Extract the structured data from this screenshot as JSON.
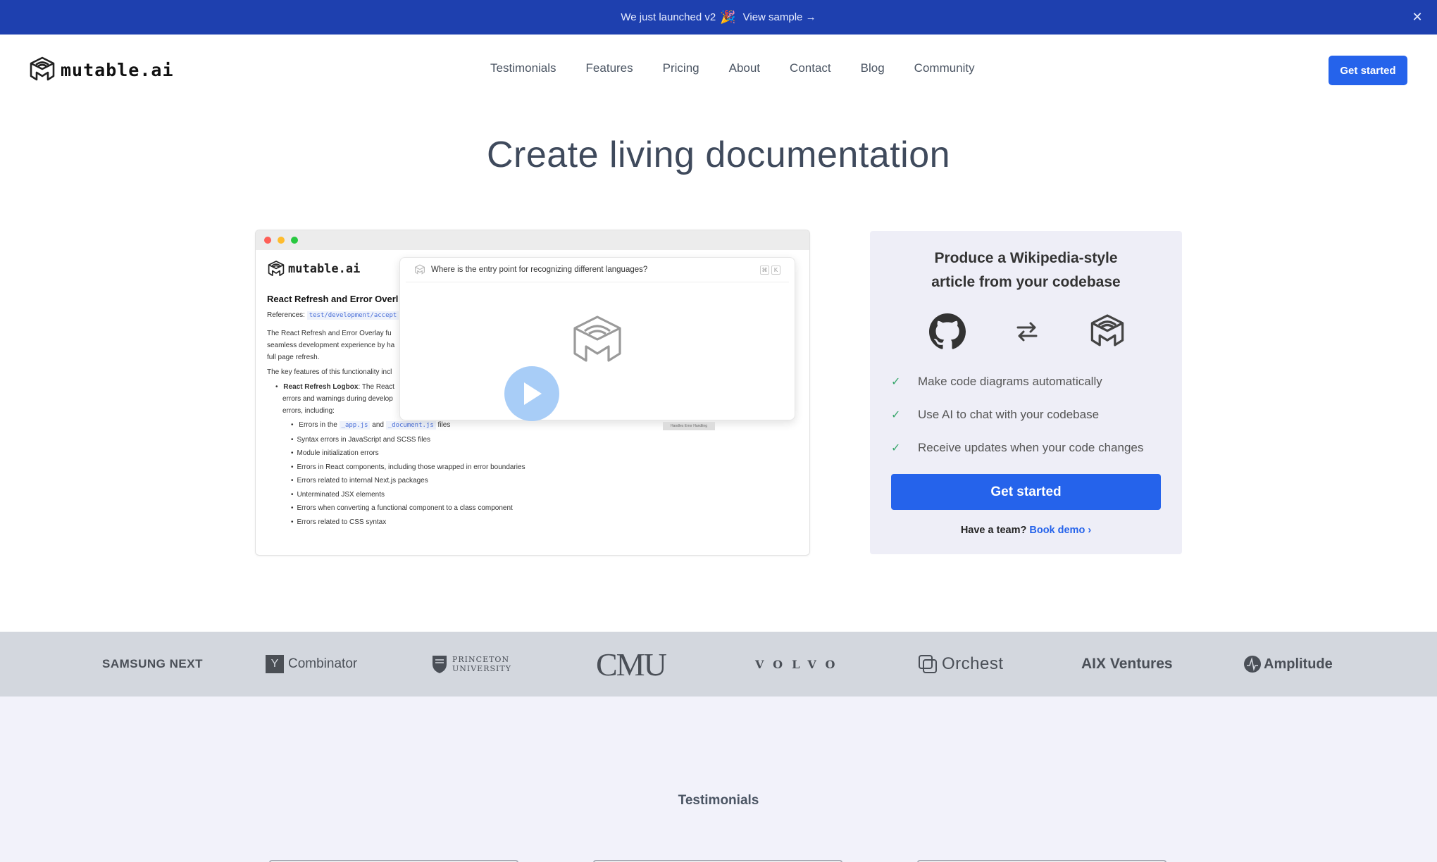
{
  "announcement": {
    "text": "We just launched v2",
    "emoji": "🎉",
    "link_label": "View sample →",
    "close_label": "✕"
  },
  "header": {
    "logo_text": "mutable.ai",
    "nav": [
      "Testimonials",
      "Features",
      "Pricing",
      "About",
      "Contact",
      "Blog",
      "Community"
    ],
    "cta_label": "Get started"
  },
  "hero": {
    "title": "Create living documentation"
  },
  "demo": {
    "logo_text": "mutable.ai",
    "doc_title": "React Refresh and Error Overl",
    "references_label": "References:",
    "references_path": "test/development/accept",
    "paragraph_lines": [
      "The React Refresh and Error Overlay fu",
      "seamless development experience by ha",
      "full page refresh."
    ],
    "key_features_line": "The key features of this functionality incl",
    "logbox_label": "React Refresh Logbox",
    "logbox_text": ": The React",
    "logbox_lines": [
      "errors and warnings during develop",
      "errors, including:"
    ],
    "errors": {
      "first_prefix": "Errors in the",
      "first_code1": "_app.js",
      "first_and": "and",
      "first_code2": "_document.js",
      "first_suffix": "files",
      "items": [
        "Syntax errors in JavaScript and SCSS files",
        "Module initialization errors",
        "Errors in React components, including those wrapped in error boundaries",
        "Errors related to internal Next.js packages",
        "Unterminated JSX elements",
        "Errors when converting a functional component to a class component",
        "Errors related to CSS syntax"
      ]
    },
    "chat_question": "Where is the entry point for recognizing different languages?",
    "chat_kbd": [
      "⌘",
      "K"
    ],
    "tooltip_text": "Handles Error Handling"
  },
  "card": {
    "title_line1": "Produce a Wikipedia-style",
    "title_line2": "article from your codebase",
    "features": [
      "Make code diagrams automatically",
      "Use AI to chat with your codebase",
      "Receive updates when your code changes"
    ],
    "cta_label": "Get started",
    "team_text": "Have a team?",
    "team_link": "Book demo ›"
  },
  "logos": {
    "samsung": "SAMSUNG NEXT",
    "yc_letter": "Y",
    "yc": "Combinator",
    "princeton_line1": "PRINCETON",
    "princeton_line2": "UNIVERSITY",
    "cmu": "CMU",
    "volvo": "VOLVO",
    "orchest": "Orchest",
    "aix": "AIX Ventures",
    "amplitude": "Amplitude"
  },
  "testimonials": {
    "title": "Testimonials"
  },
  "colors": {
    "announcement_bg": "#1e40af",
    "primary": "#2563eb",
    "check": "#3aa76d",
    "play": "#a8cdf7"
  }
}
